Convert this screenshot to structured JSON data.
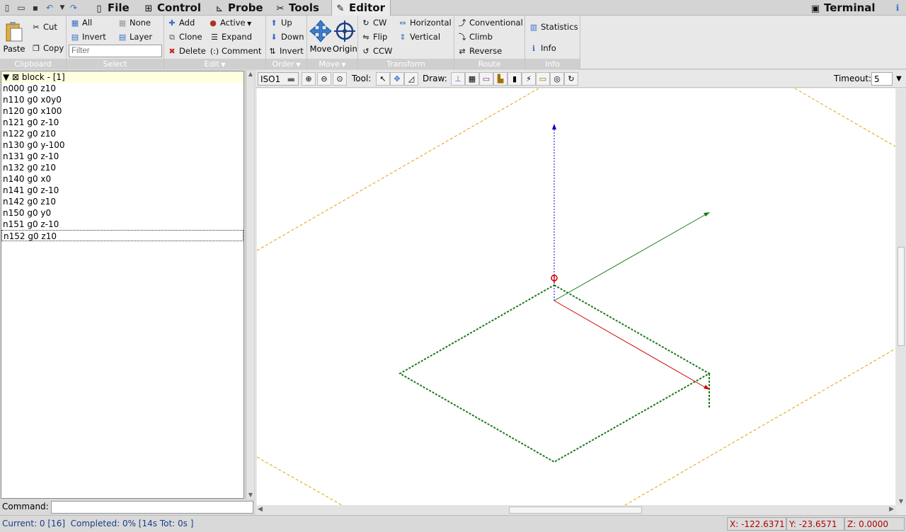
{
  "quickaccess": [
    "new-icon",
    "open-icon",
    "save-icon",
    "undo-icon",
    "dropdown-icon",
    "redo-icon"
  ],
  "tabs": {
    "file": "File",
    "control": "Control",
    "probe": "Probe",
    "tools": "Tools",
    "editor": "Editor",
    "terminal": "Terminal"
  },
  "ribbon": {
    "clipboard": {
      "label": "Clipboard",
      "paste": "Paste",
      "cut": "Cut",
      "copy": "Copy"
    },
    "select": {
      "label": "Select",
      "all": "All",
      "none": "None",
      "invert": "Invert",
      "layer": "Layer",
      "filter_placeholder": "Filter"
    },
    "edit": {
      "label": "Edit",
      "add": "Add",
      "active": "Active",
      "clone": "Clone",
      "expand": "Expand",
      "delete": "Delete",
      "comment": "Comment"
    },
    "order": {
      "label": "Order",
      "up": "Up",
      "down": "Down",
      "invert": "Invert"
    },
    "move": {
      "label": "Move",
      "move": "Move",
      "origin": "Origin"
    },
    "transform": {
      "label": "Transform",
      "cw": "CW",
      "horizontal": "Horizontal",
      "flip": "Flip",
      "vertical": "Vertical",
      "ccw": "CCW"
    },
    "route": {
      "label": "Route",
      "conventional": "Conventional",
      "climb": "Climb",
      "reverse": "Reverse"
    },
    "info": {
      "label": "Info",
      "statistics": "Statistics",
      "info": "Info"
    }
  },
  "tree": {
    "header": "▼ ⊠ block - [1]",
    "lines": [
      "n000 g0 z10",
      "n110 g0 x0y0",
      "n120 g0 x100",
      "n121 g0 z-10",
      "n122 g0 z10",
      "n130 g0 y-100",
      "n131 g0 z-10",
      "n132 g0  z10",
      "n140 g0 x0",
      "n141 g0 z-10",
      "n142 g0 z10",
      "n150 g0 y0",
      "n151 g0 z-10",
      "n152 g0 z10"
    ]
  },
  "command_label": "Command:",
  "canvas_toolbar": {
    "view": "ISO1",
    "tool_label": "Tool:",
    "draw_label": "Draw:",
    "timeout_label": "Timeout:",
    "timeout_value": "5"
  },
  "status": {
    "left": "Current: 0 [16]  Completed: 0% [14s Tot: 0s ]",
    "x": "X: -122.6371",
    "y": "Y: -23.6571",
    "z": "Z: 0.0000"
  },
  "colors": {
    "path": "#1a7a1a",
    "x_axis": "#cc0000",
    "y_axis": "#1a7a1a",
    "z_axis": "#0000cc",
    "margin": "#e0a000"
  }
}
